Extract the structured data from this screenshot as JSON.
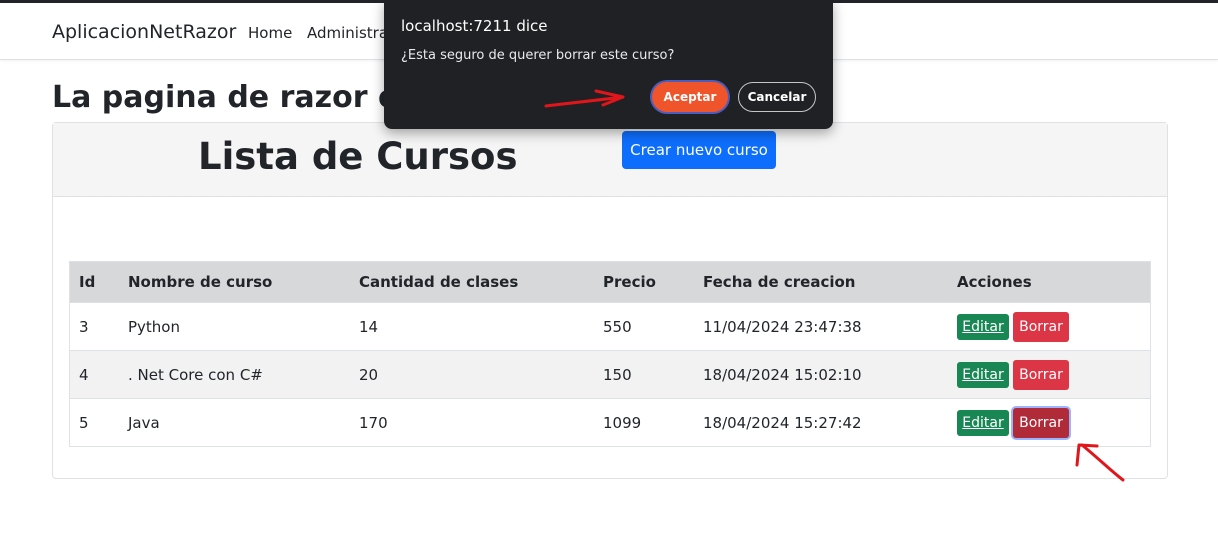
{
  "navbar": {
    "brand": "AplicacionNetRazor",
    "links": [
      "Home",
      "Administra"
    ]
  },
  "page": {
    "title": "La pagina de razor es m"
  },
  "card": {
    "title": "Lista de Cursos",
    "new_button": "Crear nuevo curso"
  },
  "table": {
    "headers": [
      "Id",
      "Nombre de curso",
      "Cantidad de clases",
      "Precio",
      "Fecha de creacion",
      "Acciones"
    ],
    "rows": [
      {
        "id": "3",
        "name": "Python",
        "classes": "14",
        "price": "550",
        "date": "11/04/2024 23:47:38",
        "edit": "Editar",
        "delete": "Borrar"
      },
      {
        "id": "4",
        "name": ". Net Core con C#",
        "classes": "20",
        "price": "150",
        "date": "18/04/2024 15:02:10",
        "edit": "Editar",
        "delete": "Borrar"
      },
      {
        "id": "5",
        "name": "Java",
        "classes": "170",
        "price": "1099",
        "date": "18/04/2024 15:27:42",
        "edit": "Editar",
        "delete": "Borrar"
      }
    ]
  },
  "dialog": {
    "origin": "localhost:7211 dice",
    "message": "¿Esta seguro de querer borrar este curso?",
    "ok_label": "Aceptar",
    "cancel_label": "Cancelar"
  },
  "colors": {
    "primary": "#0d6efd",
    "success": "#198754",
    "danger": "#dc3545",
    "dialog_bg": "#202124",
    "accept": "#f0542b",
    "annotation": "#e0161b"
  }
}
